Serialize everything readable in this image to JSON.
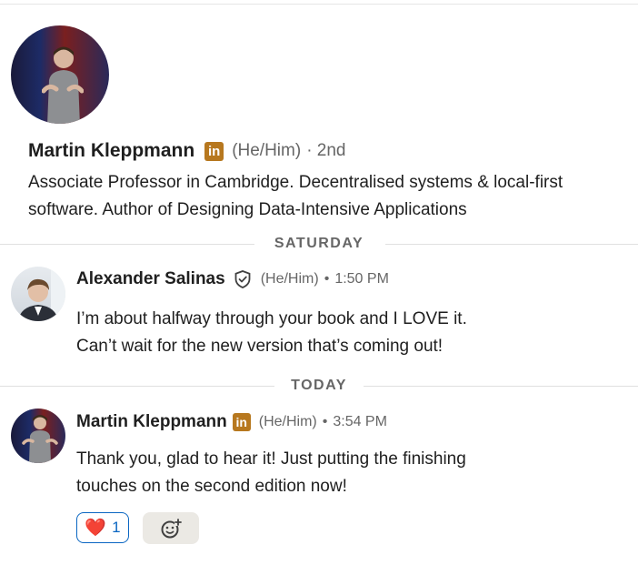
{
  "profile": {
    "name": "Martin Kleppmann",
    "badge": "in",
    "pronouns": "(He/Him)",
    "degree": "· 2nd",
    "headline": "Associate Professor in Cambridge. Decentralised systems & local-first software. Author of Designing Data-Intensive Applications"
  },
  "dividers": {
    "saturday": "SATURDAY",
    "today": "TODAY"
  },
  "messages": [
    {
      "sender": "Alexander Salinas",
      "pronouns": "(He/Him)",
      "separator": "•",
      "time": "1:50 PM",
      "line1": "I’m about halfway through your book and I LOVE it.",
      "line2": "Can’t wait for the new version that’s coming out!"
    },
    {
      "sender": "Martin Kleppmann",
      "badge": "in",
      "pronouns": "(He/Him)",
      "separator": "•",
      "time": "3:54 PM",
      "line1": "Thank you, glad to hear it! Just putting the finishing",
      "line2": "touches on the second edition now!"
    }
  ],
  "reactions": {
    "emoji": "❤️",
    "count": "1",
    "add_icon": "add-reaction-icon"
  },
  "colors": {
    "linkedin_badge": "#b7781f",
    "accent_blue": "#0a66c2",
    "heart": "#d11124"
  }
}
